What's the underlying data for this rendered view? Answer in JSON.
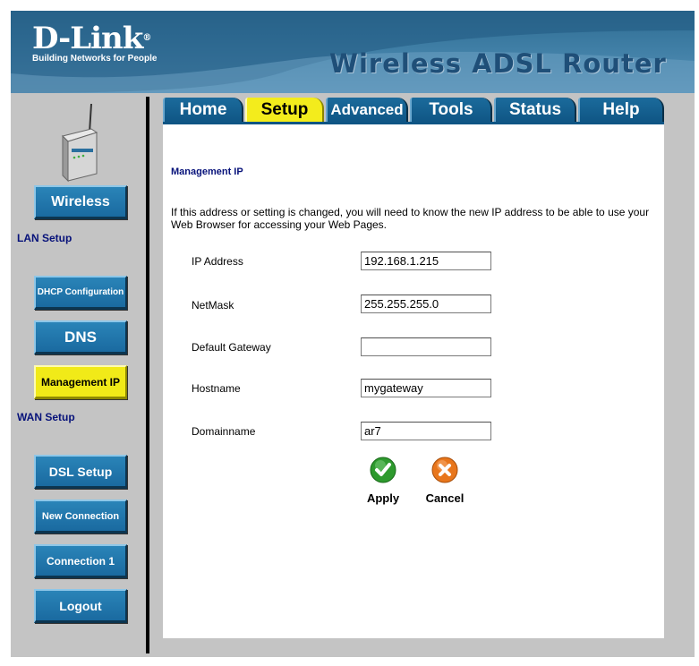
{
  "header": {
    "brand": "D-Link",
    "brand_mark": "®",
    "tagline": "Building Networks for People",
    "product": "Wireless ADSL Router"
  },
  "tabs": [
    {
      "label": "Home",
      "active": false
    },
    {
      "label": "Setup",
      "active": true
    },
    {
      "label": "Advanced",
      "active": false
    },
    {
      "label": "Tools",
      "active": false
    },
    {
      "label": "Status",
      "active": false
    },
    {
      "label": "Help",
      "active": false
    }
  ],
  "sidebar": {
    "wireless": "Wireless",
    "lan_setup": "LAN Setup",
    "dhcp": "DHCP Configuration",
    "dns": "DNS",
    "management_ip": "Management IP",
    "wan_setup": "WAN Setup",
    "dsl_setup": "DSL Setup",
    "new_connection": "New Connection",
    "connection1": "Connection 1",
    "logout": "Logout"
  },
  "main": {
    "title": "Management IP",
    "description": "If this address or setting is changed, you will need to know the new IP address to be able to use your Web Browser for accessing your Web Pages.",
    "fields": [
      {
        "label": "IP Address",
        "value": "192.168.1.215"
      },
      {
        "label": "NetMask",
        "value": "255.255.255.0"
      },
      {
        "label": "Default Gateway",
        "value": ""
      },
      {
        "label": "Hostname",
        "value": "mygateway"
      },
      {
        "label": "Domainname",
        "value": "ar7"
      }
    ],
    "apply": "Apply",
    "cancel": "Cancel"
  },
  "colors": {
    "nav_blue": "#1a6aa0",
    "active_yellow": "#f1ea18",
    "section_label": "#07127a",
    "header_blue": "#3f7ea5"
  },
  "icons": {
    "apply": "checkmark-icon",
    "cancel": "x-icon"
  }
}
